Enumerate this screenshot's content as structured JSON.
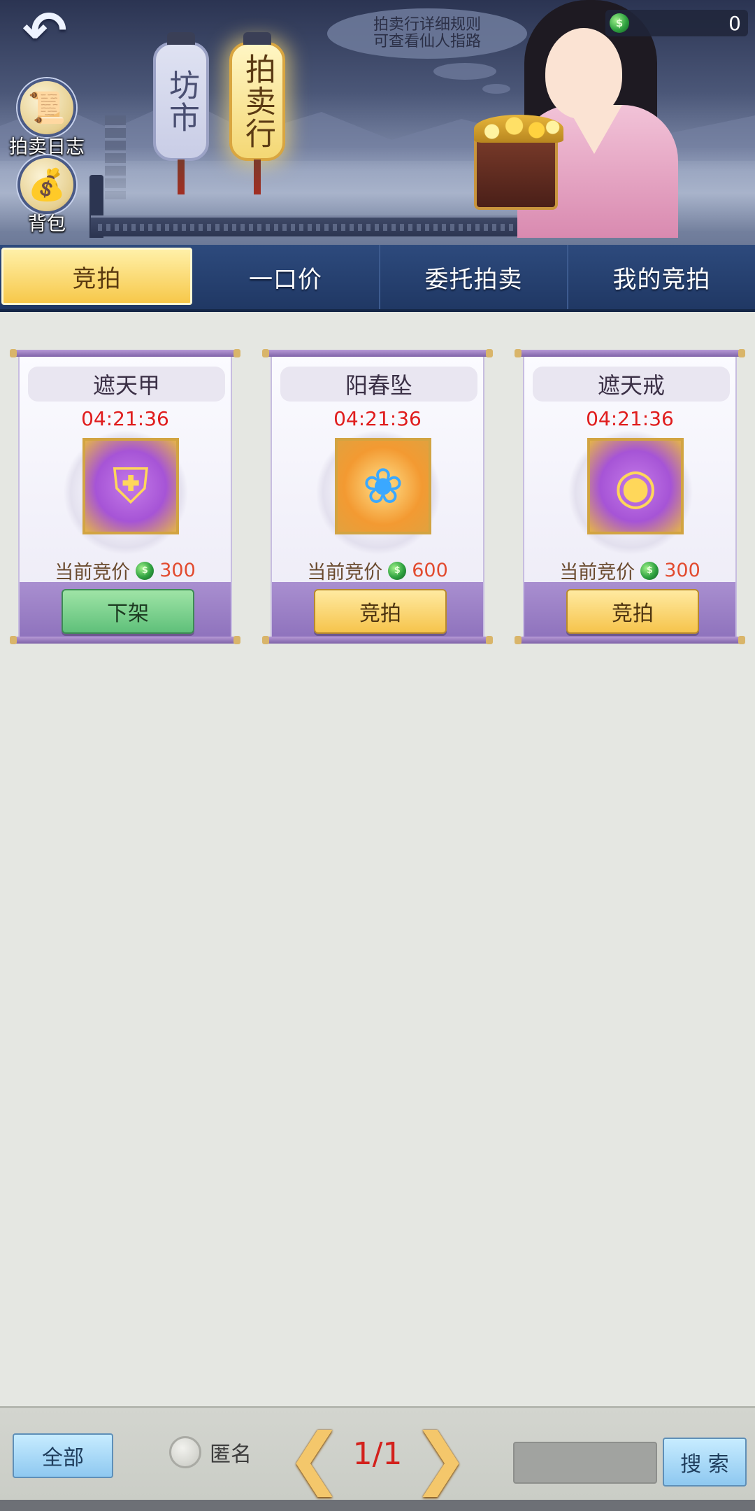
{
  "header": {
    "back_icon": "undo-arrow-icon",
    "log_label": "拍卖日志",
    "bag_label": "背包",
    "lantern_market": "坊市",
    "lantern_auction": "拍卖行",
    "hint_line1": "拍卖行详细规则",
    "hint_line2": "可查看仙人指路",
    "currency_icon": "jade-coin-icon",
    "currency_value": "0"
  },
  "tabs": [
    {
      "label": "竞拍",
      "active": true
    },
    {
      "label": "一口价",
      "active": false
    },
    {
      "label": "委托拍卖",
      "active": false
    },
    {
      "label": "我的竞拍",
      "active": false
    }
  ],
  "price_label": "当前竞价",
  "items": [
    {
      "name": "遮天甲",
      "timer": "04:21:36",
      "price": "300",
      "button": "下架",
      "icon": "armor-icon"
    },
    {
      "name": "阳春坠",
      "timer": "04:21:36",
      "price": "600",
      "button": "竞拍",
      "icon": "pendant-icon"
    },
    {
      "name": "遮天戒",
      "timer": "04:21:36",
      "price": "300",
      "button": "竞拍",
      "icon": "ring-icon"
    }
  ],
  "bottom": {
    "all_label": "全部",
    "anon_label": "匿名",
    "page": "1/1",
    "search_placeholder": "",
    "search_label": "搜 索"
  },
  "colors": {
    "tab_active": "#f7c84a",
    "tab_bar": "#2d4a7d",
    "timer": "#e01d1d",
    "price": "#e24b2f",
    "remove_button": "#5fc07a",
    "bid_button": "#f6c44c"
  }
}
